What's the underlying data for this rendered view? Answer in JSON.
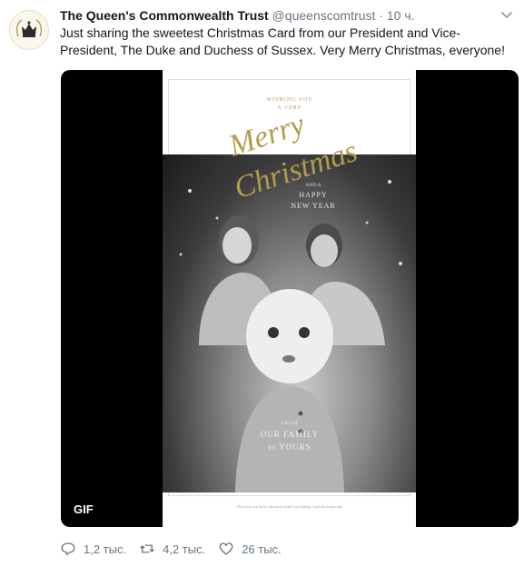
{
  "tweet": {
    "author_name": "The Queen's Commonwealth Trust",
    "handle": "@queenscomtrust",
    "separator": "·",
    "time": "10 ч.",
    "text": "Just sharing the sweetest Christmas Card from our President and Vice-President, The Duke and Duchess of Sussex. Very Merry Christmas, everyone!"
  },
  "media": {
    "badge": "GIF",
    "card": {
      "top_line1": "WISHING YOU",
      "top_line2": "A VERY",
      "merry": "Merry",
      "christmas": "Christmas",
      "and": "AND A",
      "happy": "HAPPY",
      "new_year": "NEW YEAR",
      "from": "FROM",
      "our_family": "OUR FAMILY",
      "to_yours": "to YOURS",
      "footer": "This year we have chosen to send our holiday card electronically"
    }
  },
  "actions": {
    "replies": "1,2 тыс.",
    "retweets": "4,2 тыс.",
    "likes": "26 тыс."
  },
  "icons": [
    "crown-icon",
    "chevron-down-icon",
    "reply-icon",
    "retweet-icon",
    "like-icon"
  ],
  "colors": {
    "text": "#14171a",
    "muted": "#657786",
    "gold": "#b59a4e"
  }
}
